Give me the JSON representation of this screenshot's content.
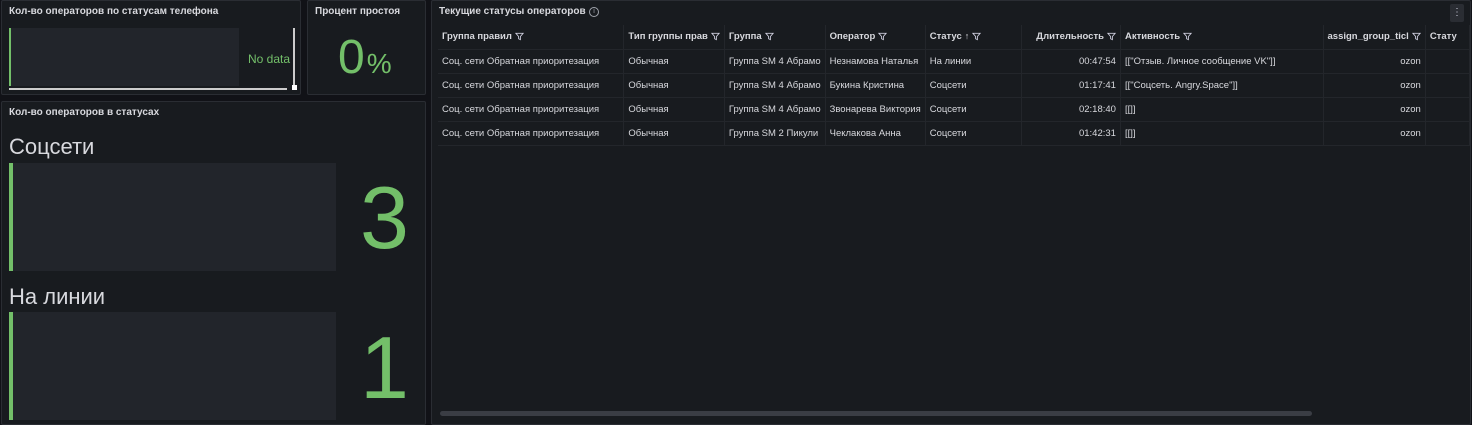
{
  "phone_panel": {
    "title": "Кол-во операторов по статусам телефона",
    "no_data": "No data"
  },
  "idle_panel": {
    "title": "Процент простоя",
    "value": "0",
    "unit": "%"
  },
  "status_panel": {
    "title": "Кол-во операторов в статусах",
    "items": [
      {
        "label": "Соцсети",
        "value": "3"
      },
      {
        "label": "На линии",
        "value": "1"
      }
    ]
  },
  "table_panel": {
    "title": "Текущие статусы операторов",
    "info_icon": "info-icon",
    "menu_icon": "⋮",
    "columns": [
      "Группа правил",
      "Тип группы прав",
      "Группа",
      "Оператор",
      "Статус",
      "Длительность",
      "Активность",
      "assign_group_ticl",
      "Стату"
    ],
    "sort_indicator": "↑",
    "rows": [
      [
        "Соц. сети Обратная приоритезация",
        "Обычная",
        "Группа SM 4 Абрамо",
        "Незнамова Наталья",
        "На линии",
        "00:47:54",
        "[[\"Отзыв. Личное сообщение VK\"]]",
        "ozon",
        ""
      ],
      [
        "Соц. сети Обратная приоритезация",
        "Обычная",
        "Группа SM 4 Абрамо",
        "Букина Кристина",
        "Соцсети",
        "01:17:41",
        "[[\"Соцсеть. Angry.Space\"]]",
        "ozon",
        ""
      ],
      [
        "Соц. сети Обратная приоритезация",
        "Обычная",
        "Группа SM 4 Абрамо",
        "Звонарева Виктория",
        "Соцсети",
        "02:18:40",
        "[[]]",
        "ozon",
        ""
      ],
      [
        "Соц. сети Обратная приоритезация",
        "Обычная",
        "Группа SM 2 Пикули",
        "Чеклакова Анна",
        "Соцсети",
        "01:42:31",
        "[[]]",
        "ozon",
        ""
      ]
    ]
  },
  "colors": {
    "accent_green": "#73bf69",
    "panel_bg": "#181b1f",
    "page_bg": "#111217"
  }
}
